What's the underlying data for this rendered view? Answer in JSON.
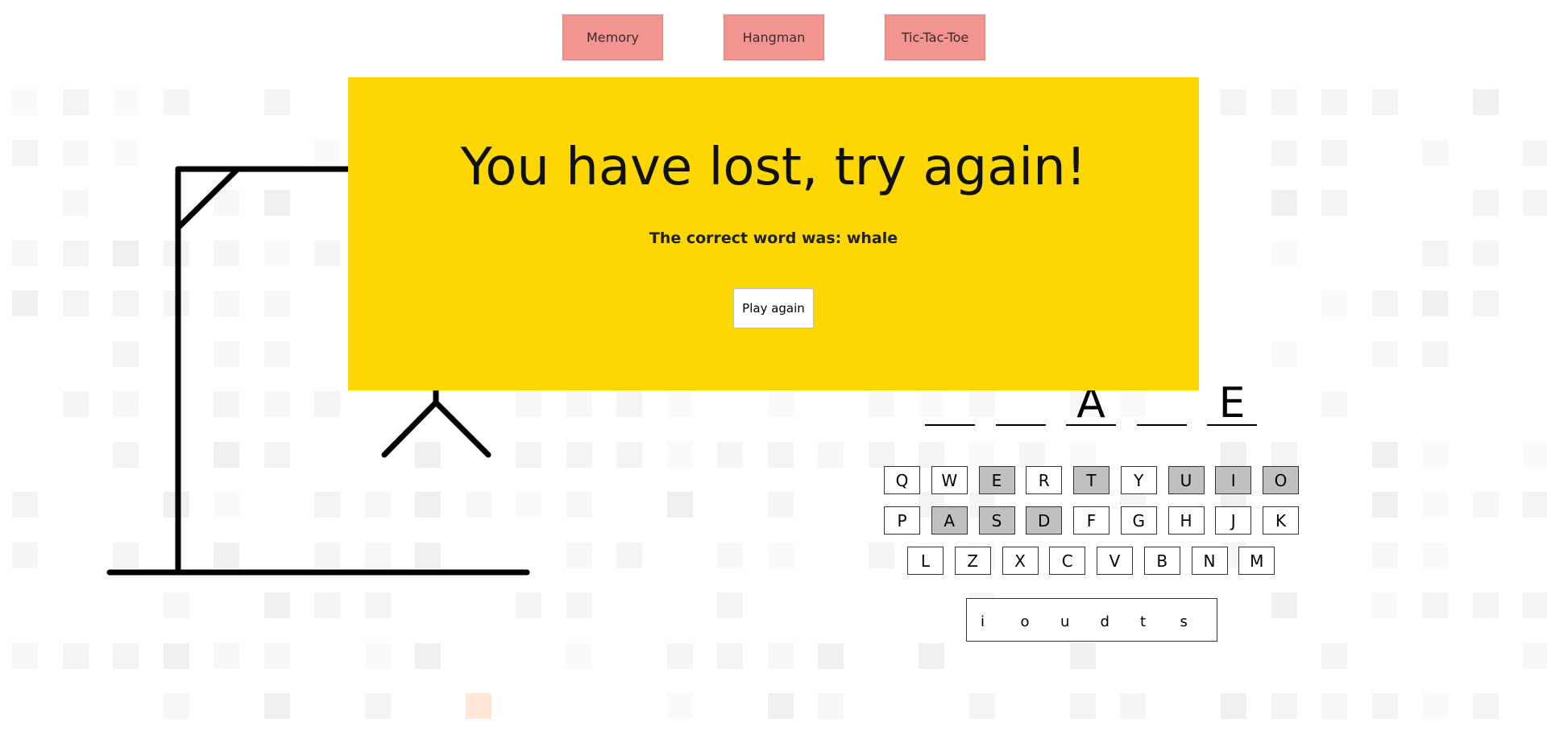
{
  "nav": [
    "Memory",
    "Hangman",
    "Tic-Tac-Toe"
  ],
  "modal": {
    "title": "You have lost, try again!",
    "subtitle": "The correct word was: whale",
    "button_label": "Play again"
  },
  "word_slots": [
    "",
    "",
    "A",
    "",
    "E"
  ],
  "keyboard_rows": [
    [
      "Q",
      "W",
      "E",
      "R",
      "T",
      "Y",
      "U",
      "I",
      "O"
    ],
    [
      "P",
      "A",
      "S",
      "D",
      "F",
      "G",
      "H",
      "J",
      "K"
    ],
    [
      "L",
      "Z",
      "X",
      "C",
      "V",
      "B",
      "N",
      "M"
    ]
  ],
  "used_keys": [
    "E",
    "T",
    "U",
    "I",
    "O",
    "A",
    "S",
    "D"
  ],
  "guessed_letters": [
    "i",
    "o",
    "u",
    "d",
    "t",
    "s"
  ],
  "colors": {
    "nav_button": "#f29490",
    "modal_background": "#fdd703",
    "used_key": "#c0c0c0"
  }
}
